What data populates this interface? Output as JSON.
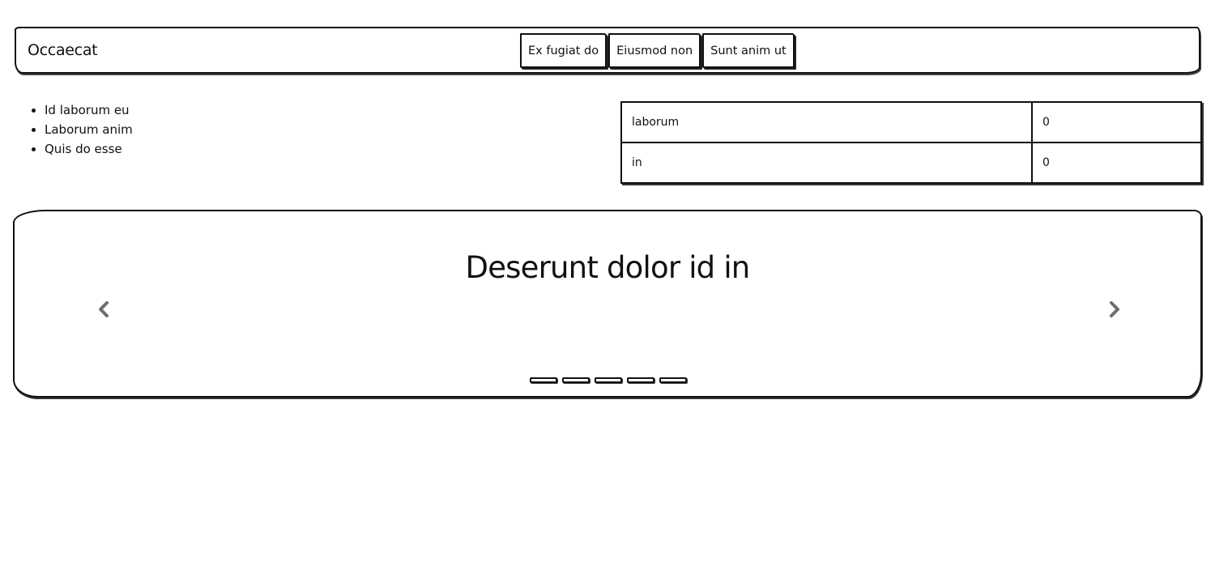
{
  "navbar": {
    "brand": "Occaecat",
    "buttons": [
      "Ex fugiat do",
      "Eiusmod non",
      "Sunt anim ut"
    ]
  },
  "list": {
    "items": [
      "Id laborum eu",
      "Laborum anim",
      "Quis do esse"
    ]
  },
  "table": {
    "rows": [
      {
        "key": "laborum",
        "value": "0"
      },
      {
        "key": "in",
        "value": "0"
      }
    ]
  },
  "carousel": {
    "title": "Deserunt dolor id in",
    "prev_icon": "chevron-left-icon",
    "next_icon": "chevron-right-icon",
    "slide_count": 5
  }
}
